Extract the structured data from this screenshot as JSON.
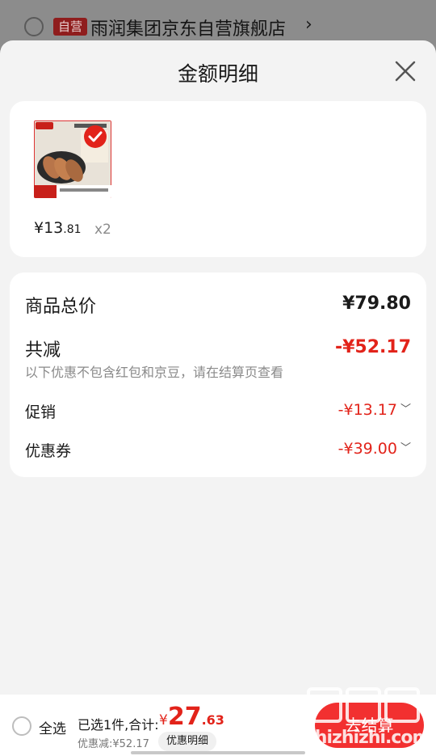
{
  "store": {
    "tag": "自营",
    "name": "雨润集团京东自营旗舰店",
    "chevron": "›"
  },
  "sheet": {
    "title": "金额明细",
    "close_icon": "close-icon"
  },
  "product": {
    "image_icon": "product-image",
    "price_int": "¥13",
    "price_dec": ".81",
    "quantity": "x2",
    "selected": true
  },
  "summary": {
    "total_label": "商品总价",
    "total_value": "¥79.80",
    "reduce_label": "共减",
    "reduce_value": "-¥52.17",
    "note": "以下优惠不包含红包和京豆，请在结算页查看",
    "promo_label": "促销",
    "promo_value": "-¥13.17",
    "coupon_label": "优惠券",
    "coupon_value": "-¥39.00"
  },
  "bottom": {
    "select_all": "全选",
    "selected_count": "已选1件,合计:",
    "currency": "¥",
    "total_int": "27",
    "total_dec": ".63",
    "discount": "优惠减:¥52.17",
    "detail_button": "优惠明细",
    "checkout_button": "去结算"
  },
  "watermark": {
    "text": "zhizhizhi.com"
  },
  "colors": {
    "accent": "#e2231a",
    "sheet_bg": "#f3f3f3",
    "card_bg": "#ffffff"
  }
}
